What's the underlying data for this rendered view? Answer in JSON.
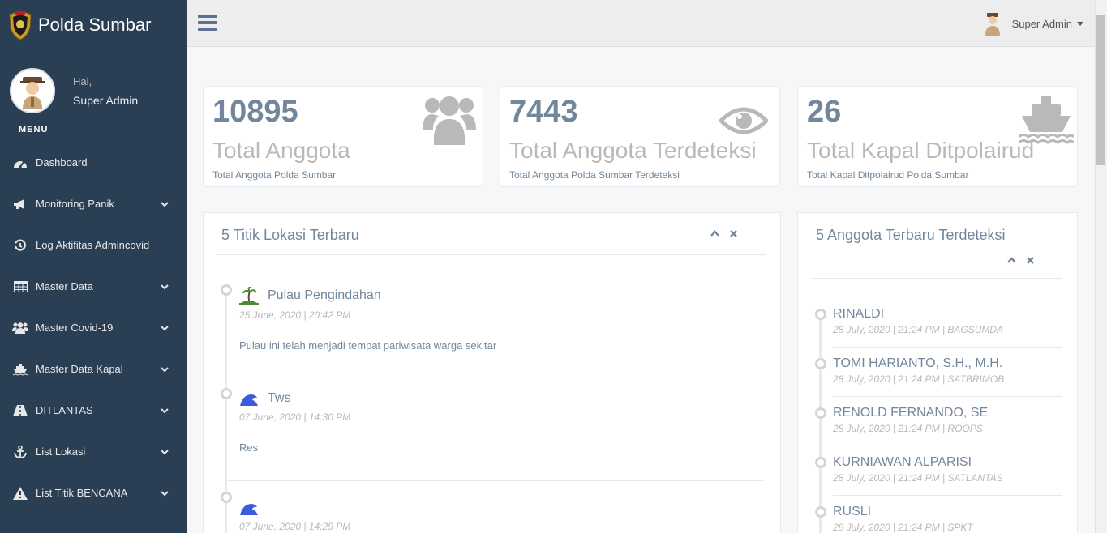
{
  "brand": {
    "name": "Polda Sumbar",
    "logo_icon": "police-badge-icon"
  },
  "profile": {
    "greeting": "Hai,",
    "name": "Super Admin"
  },
  "sidebar": {
    "menu_title": "MENU",
    "items": [
      {
        "label": "Dashboard",
        "icon": "dashboard-icon",
        "has_sub": false
      },
      {
        "label": "Monitoring Panik",
        "icon": "bullhorn-icon",
        "has_sub": true
      },
      {
        "label": "Log Aktifitas Admincovid",
        "icon": "history-icon",
        "has_sub": false
      },
      {
        "label": "Master Data",
        "icon": "table-icon",
        "has_sub": true
      },
      {
        "label": "Master Covid-19",
        "icon": "users-icon",
        "has_sub": true
      },
      {
        "label": "Master Data Kapal",
        "icon": "ship-icon",
        "has_sub": true
      },
      {
        "label": "DITLANTAS",
        "icon": "road-icon",
        "has_sub": true
      },
      {
        "label": "List Lokasi",
        "icon": "anchor-icon",
        "has_sub": true
      },
      {
        "label": "List Titik BENCANA",
        "icon": "warning-icon",
        "has_sub": true
      }
    ]
  },
  "topbar": {
    "user_name": "Super Admin"
  },
  "tiles": [
    {
      "count": "10895",
      "title": "Total Anggota",
      "desc": "Total Anggota Polda Sumbar",
      "icon": "users-icon"
    },
    {
      "count": "7443",
      "title": "Total Anggota Terdeteksi",
      "desc": "Total Anggota Polda Sumbar Terdeteksi",
      "icon": "eye-icon"
    },
    {
      "count": "26",
      "title": "Total Kapal Ditpolairud",
      "desc": "Total Kapal Ditpolairud Polda Sumbar",
      "icon": "ship-icon"
    }
  ],
  "locations_panel": {
    "title": "5 Titik Lokasi Terbaru",
    "items": [
      {
        "name": "Pulau Pengindahan",
        "icon": "island-icon",
        "when": "25 June, 2020 | 20:42 PM",
        "body": "Pulau ini telah menjadi tempat pariwisata warga sekitar"
      },
      {
        "name": "Tws",
        "icon": "wave-icon",
        "when": "07 June, 2020 | 14:30 PM",
        "body": "Res"
      },
      {
        "name": "",
        "icon": "wave-icon",
        "when": "07 June, 2020 | 14:29 PM",
        "body": ""
      }
    ]
  },
  "members_panel": {
    "title": "5 Anggota Terbaru Terdeteksi",
    "items": [
      {
        "name": "RINALDI",
        "when": "28 July, 2020 | 21:24 PM | BAGSUMDA"
      },
      {
        "name": "TOMI HARIANTO, S.H., M.H.",
        "when": "28 July, 2020 | 21:24 PM | SATBRIMOB"
      },
      {
        "name": "RENOLD FERNANDO, SE",
        "when": "28 July, 2020 | 21:24 PM | ROOPS"
      },
      {
        "name": "KURNIAWAN ALPARISI",
        "when": "28 July, 2020 | 21:24 PM | SATLANTAS"
      },
      {
        "name": "RUSLI",
        "when": "28 July, 2020 | 21:24 PM | SPKT"
      }
    ]
  },
  "colors": {
    "sidebar": "#2a3f54",
    "text": "#73879c",
    "muted": "#bab8b8",
    "wave": "#3b5bdb",
    "island": "#4a8a3a"
  }
}
